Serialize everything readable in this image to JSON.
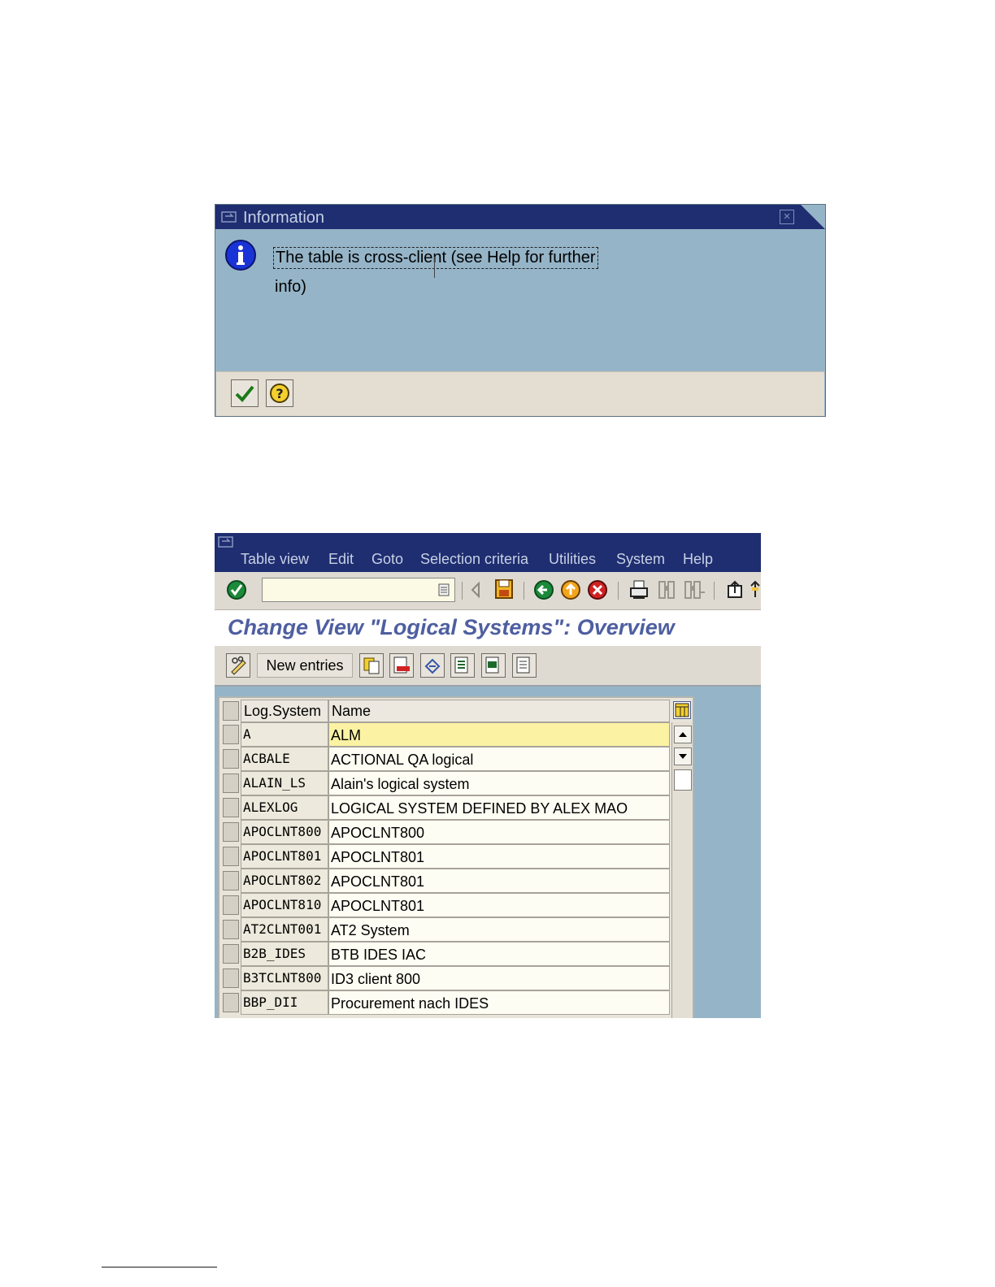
{
  "info_dialog": {
    "title": "Information",
    "message_line1": "The table is cross-client (see Help for further",
    "message_line2": "info)"
  },
  "sap_window": {
    "menu": [
      "Table view",
      "Edit",
      "Goto",
      "Selection criteria",
      "Utilities",
      "System",
      "Help"
    ],
    "page_title": "Change View \"Logical Systems\": Overview",
    "new_entries_label": "New entries",
    "table": {
      "columns": [
        "Log.System",
        "Name"
      ],
      "rows": [
        {
          "system": "A",
          "name": "ALM"
        },
        {
          "system": "ACBALE",
          "name": "ACTIONAL QA logical"
        },
        {
          "system": "ALAIN_LS",
          "name": "Alain's logical system"
        },
        {
          "system": "ALEXLOG",
          "name": "LOGICAL SYSTEM DEFINED BY ALEX MAO"
        },
        {
          "system": "APOCLNT800",
          "name": "APOCLNT800"
        },
        {
          "system": "APOCLNT801",
          "name": "APOCLNT801"
        },
        {
          "system": "APOCLNT802",
          "name": "APOCLNT801"
        },
        {
          "system": "APOCLNT810",
          "name": "APOCLNT801"
        },
        {
          "system": "AT2CLNT001",
          "name": "AT2 System"
        },
        {
          "system": "B2B_IDES",
          "name": "BTB IDES IAC"
        },
        {
          "system": "B3TCLNT800",
          "name": "ID3 client  800"
        },
        {
          "system": "BBP_DII",
          "name": "Procurement nach IDES"
        }
      ]
    }
  },
  "colors": {
    "title_bar": "#1f2d71",
    "panel": "#95b4c7",
    "toolbar": "#dedad2",
    "page_title": "#4e5fa0",
    "active_row": "#fcf2a4"
  }
}
